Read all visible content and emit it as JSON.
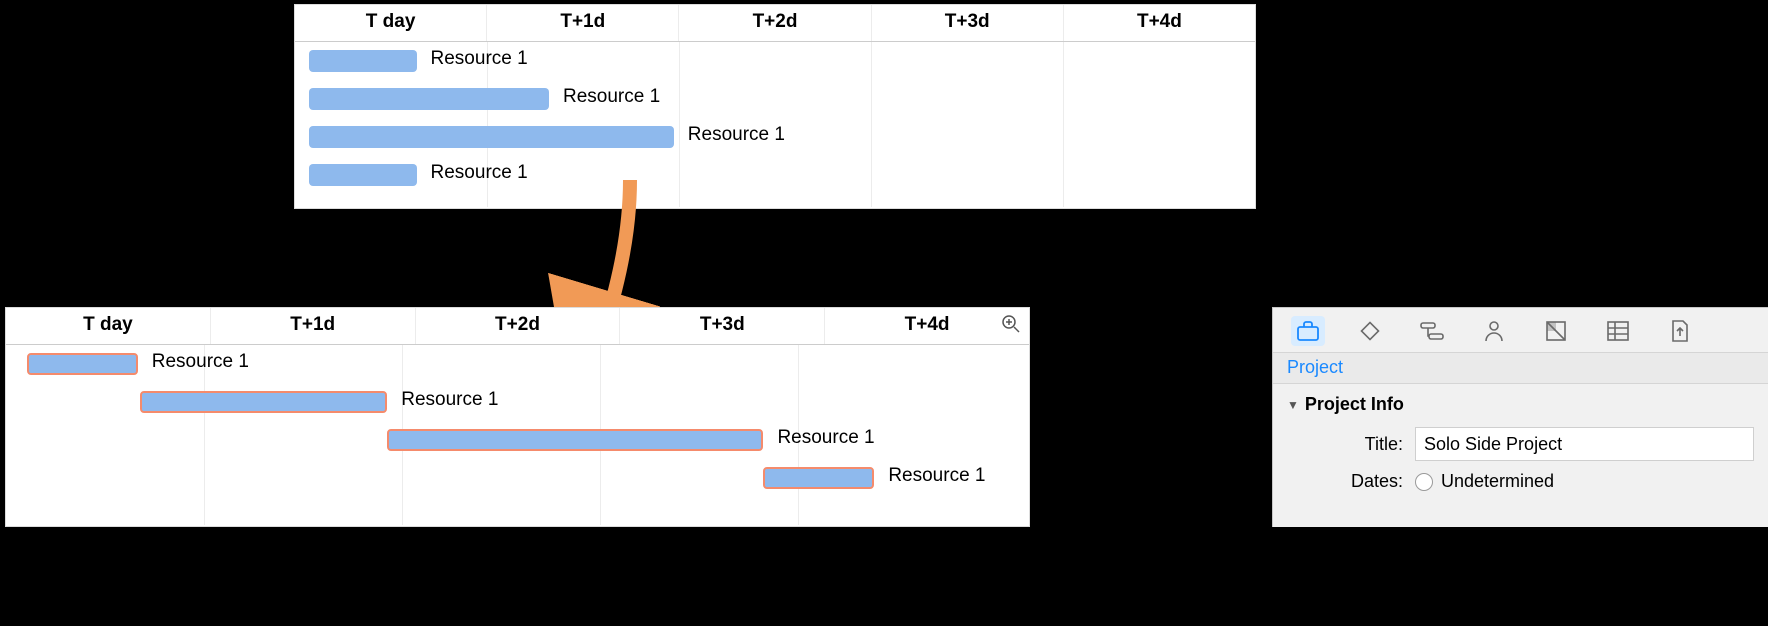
{
  "top_panel": {
    "columns": [
      "T day",
      "T+1d",
      "T+2d",
      "T+3d",
      "T+4d"
    ],
    "tasks": [
      {
        "start_col": 0,
        "width_cols": 0.56,
        "label": "Resource 1",
        "selected": false
      },
      {
        "start_col": 0,
        "width_cols": 1.25,
        "label": "Resource 1",
        "selected": false
      },
      {
        "start_col": 0,
        "width_cols": 1.9,
        "label": "Resource 1",
        "selected": false
      },
      {
        "start_col": 0,
        "width_cols": 0.56,
        "label": "Resource 1",
        "selected": false
      }
    ]
  },
  "bottom_panel": {
    "columns": [
      "T day",
      "T+1d",
      "T+2d",
      "T+3d",
      "T+4d"
    ],
    "tasks": [
      {
        "start_col": -0.45,
        "width_cols": 0.56,
        "label": "Resource 1",
        "selected": true
      },
      {
        "start_col": 0.12,
        "width_cols": 1.25,
        "label": "Resource 1",
        "selected": true
      },
      {
        "start_col": 1.37,
        "width_cols": 1.9,
        "label": "Resource 1",
        "selected": true
      },
      {
        "start_col": 3.27,
        "width_cols": 0.56,
        "label": "Resource 1",
        "selected": true
      }
    ],
    "zoom_icon": "zoom-in-icon"
  },
  "inspector": {
    "tabs": [
      "project-tab",
      "milestone-tab",
      "task-tab",
      "resource-tab",
      "styles-tab",
      "custom-data-tab",
      "export-tab"
    ],
    "active_tab_index": 0,
    "subtitle": "Project",
    "section_label": "Project Info",
    "title_label": "Title:",
    "title_value": "Solo Side Project",
    "dates_label": "Dates:",
    "dates_options": [
      {
        "label": "Undetermined",
        "checked": false
      }
    ]
  },
  "arrow": {
    "color": "#f19a56"
  }
}
